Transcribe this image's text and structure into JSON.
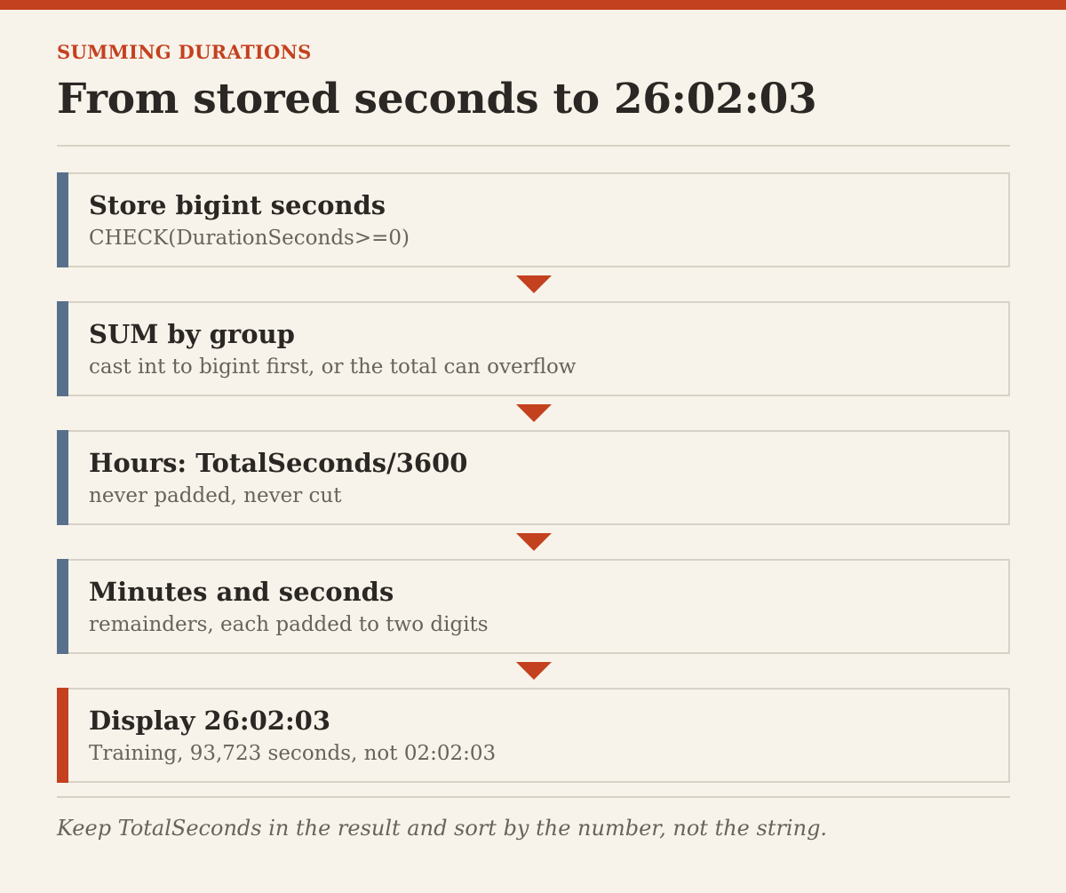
{
  "header": {
    "eyebrow": "SUMMING DURATIONS",
    "title": "From stored seconds to 26:02:03"
  },
  "steps": [
    {
      "label": "Store bigint seconds",
      "sub": "CHECK(DurationSeconds>=0)"
    },
    {
      "label": "SUM by group",
      "sub": "cast int to bigint first, or the total can overflow"
    },
    {
      "label": "Hours: TotalSeconds/3600",
      "sub": "never padded, never cut"
    },
    {
      "label": "Minutes and seconds",
      "sub": "remainders, each padded to two digits"
    },
    {
      "label": "Display 26:02:03",
      "sub": "Training, 93,723 seconds, not 02:02:03"
    }
  ],
  "footnote": "Keep TotalSeconds in the result and sort by the number, not the string.",
  "colors": {
    "accent": "#c4411f",
    "step_bar": "#58708c",
    "background": "#f8f3ea",
    "border": "#d8d1c6"
  }
}
